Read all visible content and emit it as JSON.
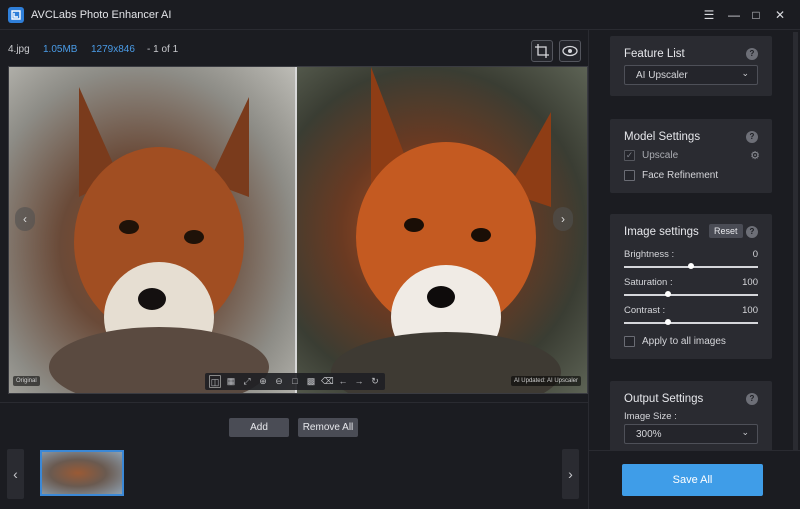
{
  "window": {
    "title": "AVCLabs Photo Enhancer AI",
    "menu_icon": "hamburger-icon",
    "minimize_icon": "minimize-icon",
    "maximize_icon": "maximize-icon",
    "close_icon": "close-icon"
  },
  "file_info": {
    "name": "4.jpg",
    "size": "1.05MB",
    "dimensions": "1279x846",
    "page": "- 1 of 1"
  },
  "viewer": {
    "left_label": "Original",
    "right_label": "AI Updated: AI Upscaler",
    "tools": [
      "compare-icon",
      "split-view-icon",
      "fullscreen-icon",
      "zoom-in-icon",
      "zoom-out-icon",
      "crop-icon",
      "save-icon",
      "delete-icon",
      "undo-icon",
      "redo-icon",
      "rotate-icon"
    ]
  },
  "actions": {
    "add_label": "Add",
    "remove_all_label": "Remove All"
  },
  "panels": {
    "feature_list": {
      "title": "Feature List",
      "selected": "AI Upscaler"
    },
    "model_settings": {
      "title": "Model Settings",
      "upscale_label": "Upscale",
      "upscale_checked": true,
      "face_refinement_label": "Face Refinement",
      "face_refinement_checked": false
    },
    "image_settings": {
      "title": "Image settings",
      "reset_label": "Reset",
      "brightness_label": "Brightness :",
      "brightness_value": "0",
      "brightness_fraction": 0.5,
      "saturation_label": "Saturation :",
      "saturation_value": "100",
      "saturation_fraction": 0.33,
      "contrast_label": "Contrast :",
      "contrast_value": "100",
      "contrast_fraction": 0.33,
      "apply_all_label": "Apply to all images",
      "apply_all_checked": false
    },
    "output_settings": {
      "title": "Output Settings",
      "image_size_label": "Image Size :",
      "image_size_value": "300%"
    }
  },
  "footer": {
    "save_all_label": "Save All"
  },
  "colors": {
    "accent": "#3f9de8",
    "info_blue": "#4a9be6",
    "background": "#1b1c21",
    "panel": "#2a2b31"
  }
}
